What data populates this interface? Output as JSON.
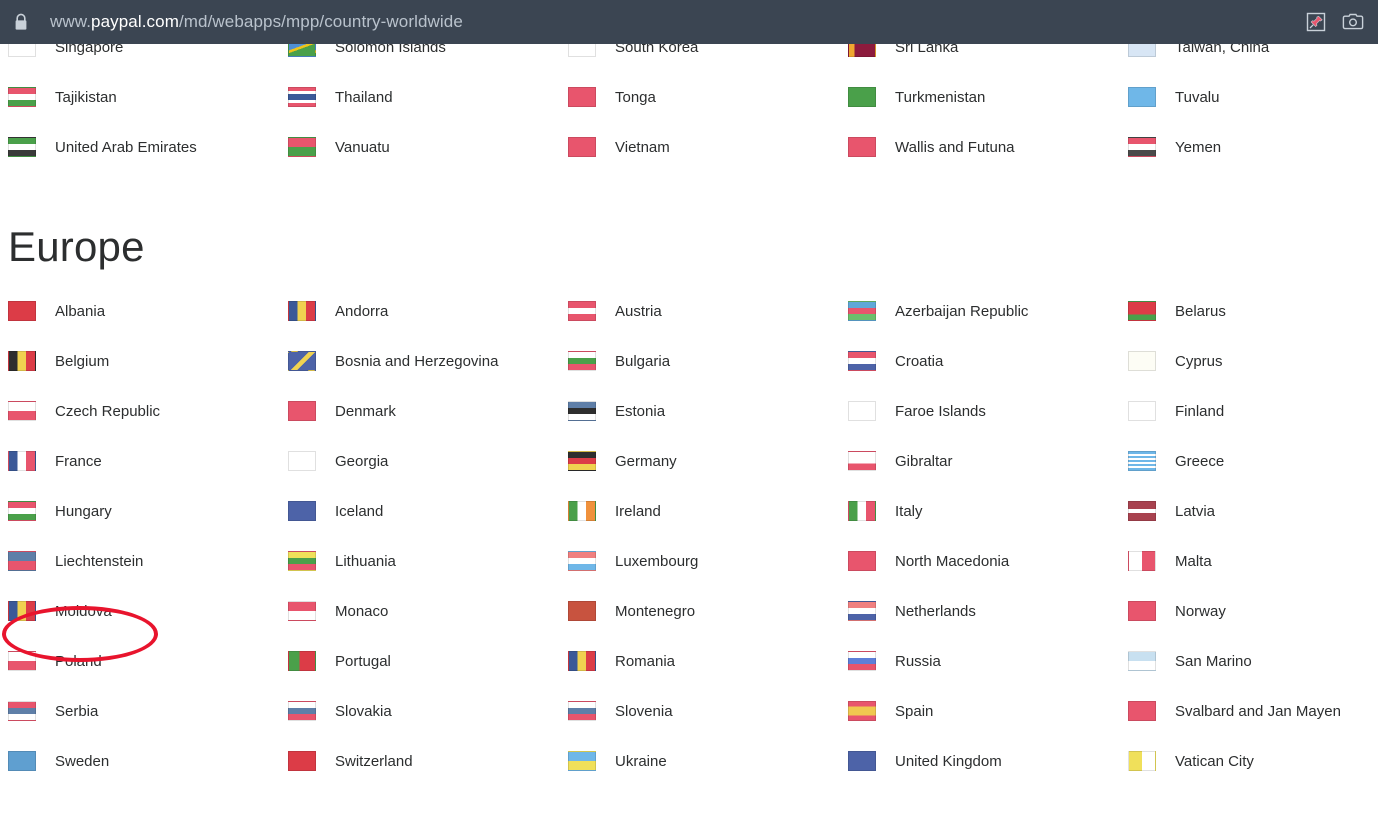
{
  "browser": {
    "url_prefix": "www.",
    "url_host": "paypal.com",
    "url_path": "/md/webapps/mpp/country-worldwide",
    "url_full": "www.paypal.com/md/webapps/mpp/country-worldwide",
    "lock_icon": "lock-icon",
    "pin_icon": "pin-icon",
    "camera_icon": "camera-icon"
  },
  "annotation": {
    "type": "red-ellipse",
    "color": "#e8142d",
    "target": "Moldova"
  },
  "clipped_section": {
    "rows": [
      [
        "Singapore",
        "Solomon Islands",
        "South Korea",
        "Sri Lanka",
        "Taiwan, China"
      ]
    ]
  },
  "asia_pacific": {
    "rows": [
      [
        "Tajikistan",
        "Thailand",
        "Tonga",
        "Turkmenistan",
        "Tuvalu"
      ],
      [
        "United Arab Emirates",
        "Vanuatu",
        "Vietnam",
        "Wallis and Futuna",
        "Yemen"
      ]
    ]
  },
  "europe": {
    "heading": "Europe",
    "rows": [
      [
        "Albania",
        "Andorra",
        "Austria",
        "Azerbaijan Republic",
        "Belarus"
      ],
      [
        "Belgium",
        "Bosnia and Herzegovina",
        "Bulgaria",
        "Croatia",
        "Cyprus"
      ],
      [
        "Czech Republic",
        "Denmark",
        "Estonia",
        "Faroe Islands",
        "Finland"
      ],
      [
        "France",
        "Georgia",
        "Germany",
        "Gibraltar",
        "Greece"
      ],
      [
        "Hungary",
        "Iceland",
        "Ireland",
        "Italy",
        "Latvia"
      ],
      [
        "Liechtenstein",
        "Lithuania",
        "Luxembourg",
        "North Macedonia",
        "Malta"
      ],
      [
        "Moldova",
        "Monaco",
        "Montenegro",
        "Netherlands",
        "Norway"
      ],
      [
        "Poland",
        "Portugal",
        "Romania",
        "Russia",
        "San Marino"
      ],
      [
        "Serbia",
        "Slovakia",
        "Slovenia",
        "Spain",
        "Svalbard and Jan Mayen"
      ],
      [
        "Sweden",
        "Switzerland",
        "Ukraine",
        "United Kingdom",
        "Vatican City"
      ]
    ]
  },
  "flag_styles": {
    "Singapore": "linear-gradient(#ffffff 0 50%, #ffffff 50% 100%)",
    "Solomon Islands": "linear-gradient(160deg, #4f8fd4 0 45%, #f0c419 45% 55%, #4aa04a 55% 100%)",
    "South Korea": "linear-gradient(#ffffff 0 100%)",
    "Sri Lanka": "linear-gradient(90deg, #f0a830 0 22%, #8d1b3d 22% 100%)",
    "Taiwan, China": "linear-gradient(#d8e6f5 0 100%)",
    "Tajikistan": "linear-gradient(#e8556d 0 33%, #ffffff 33% 66%, #4aa04a 66% 100%)",
    "Thailand": "linear-gradient(#e8556d 0 17%, #ffffff 17% 33%, #3b5998 33% 66%, #ffffff 66% 83%, #e8556d 83% 100%)",
    "Tonga": "linear-gradient(#e8556d 0 100%)",
    "Turkmenistan": "linear-gradient(#4aa04a 0 100%)",
    "Tuvalu": "linear-gradient(#6fb7e8 0 100%)",
    "United Arab Emirates": "linear-gradient(#4aa04a 0 33%, #ffffff 33% 66%, #3a3a3a 66% 100%)",
    "Vanuatu": "linear-gradient(#e8556d 0 50%, #4aa04a 50% 100%)",
    "Vietnam": "linear-gradient(#e8556d 0 100%)",
    "Wallis and Futuna": "linear-gradient(#e8556d 0 100%)",
    "Yemen": "linear-gradient(#e8556d 0 33%, #ffffff 33% 66%, #4a4a4a 66% 100%)",
    "Albania": "linear-gradient(#dc3c47 0 100%)",
    "Andorra": "linear-gradient(90deg, #3b5998 0 33%, #f0d250 33% 66%, #dc3c47 66% 100%)",
    "Austria": "linear-gradient(#e8556d 0 33%, #ffffff 33% 66%, #e8556d 66% 100%)",
    "Azerbaijan Republic": "linear-gradient(#5fa8d8 0 33%, #e8556d 33% 66%, #6cbf6c 66% 100%)",
    "Belarus": "linear-gradient(#dc3c47 0 70%, #4aa04a 70% 100%)",
    "Belgium": "linear-gradient(90deg, #2e2e2e 0 33%, #f0d250 33% 66%, #dc3c47 66% 100%)",
    "Bosnia and Herzegovina": "linear-gradient(135deg, #4d63a8 0 45%, #f0d250 45% 60%, #4d63a8 60% 100%)",
    "Bulgaria": "linear-gradient(#ffffff 0 33%, #4aa04a 33% 66%, #e8556d 66% 100%)",
    "Croatia": "linear-gradient(#e8556d 0 33%, #ffffff 33% 66%, #4d63a8 66% 100%)",
    "Cyprus": "linear-gradient(#fdfdf5 0 100%)",
    "Czech Republic": "linear-gradient(#ffffff 0 50%, #e8556d 50% 100%)",
    "Denmark": "linear-gradient(#e8556d 0 100%)",
    "Estonia": "linear-gradient(#5f7fa8 0 33%, #2e2e2e 33% 66%, #ffffff 66% 100%)",
    "Faroe Islands": "linear-gradient(#ffffff 0 100%)",
    "Finland": "linear-gradient(#ffffff 0 100%)",
    "France": "linear-gradient(90deg, #3b5998 0 33%, #ffffff 33% 66%, #e8556d 66% 100%)",
    "Georgia": "linear-gradient(#ffffff 0 100%)",
    "Germany": "linear-gradient(#2e2e2e 0 33%, #dc3c47 33% 66%, #f0d250 66% 100%)",
    "Gibraltar": "linear-gradient(#ffffff 0 65%, #e8556d 65% 100%)",
    "Greece": "repeating-linear-gradient(#6fb7e8 0 11%, #ffffff 11% 22%)",
    "Hungary": "linear-gradient(#e8556d 0 33%, #ffffff 33% 66%, #4aa04a 66% 100%)",
    "Iceland": "linear-gradient(#4d63a8 0 100%)",
    "Ireland": "linear-gradient(90deg, #4aa04a 0 33%, #ffffff 33% 66%, #f0913c 66% 100%)",
    "Italy": "linear-gradient(90deg, #4aa04a 0 33%, #ffffff 33% 66%, #e8556d 66% 100%)",
    "Latvia": "linear-gradient(#a8424f 0 40%, #ffffff 40% 60%, #a8424f 60% 100%)",
    "Liechtenstein": "linear-gradient(#5f7fa8 0 50%, #e8556d 50% 100%)",
    "Lithuania": "linear-gradient(#f0e05a 0 33%, #4aa04a 33% 66%, #e8556d 66% 100%)",
    "Luxembourg": "linear-gradient(#f08080 0 33%, #ffffff 33% 66%, #6fb7e8 66% 100%)",
    "North Macedonia": "linear-gradient(#e8556d 0 100%)",
    "Malta": "linear-gradient(90deg, #ffffff 0 50%, #e8556d 50% 100%)",
    "Moldova": "linear-gradient(90deg, #3b5998 0 33%, #f0d250 33% 66%, #dc3c47 66% 100%)",
    "Monaco": "linear-gradient(#e8556d 0 50%, #ffffff 50% 100%)",
    "Montenegro": "linear-gradient(#c8533f 0 100%)",
    "Netherlands": "linear-gradient(#f08080 0 33%, #ffffff 33% 66%, #4d63a8 66% 100%)",
    "Norway": "linear-gradient(#e8556d 0 100%)",
    "Poland": "linear-gradient(#ffffff 0 50%, #e8556d 50% 100%)",
    "Portugal": "linear-gradient(90deg, #4aa04a 0 40%, #dc3c47 40% 100%)",
    "Romania": "linear-gradient(90deg, #3b5998 0 33%, #f0d250 33% 66%, #dc3c47 66% 100%)",
    "Russia": "linear-gradient(#ffffff 0 33%, #5f7fd8 33% 66%, #e8556d 66% 100%)",
    "San Marino": "linear-gradient(#c8e0f0 0 50%, #ffffff 50% 100%)",
    "Serbia": "linear-gradient(#e8556d 0 33%, #5f7fa8 33% 66%, #ffffff 66% 100%)",
    "Slovakia": "linear-gradient(#ffffff 0 33%, #5f7fa8 33% 66%, #e8556d 66% 100%)",
    "Slovenia": "linear-gradient(#ffffff 0 33%, #5f7fa8 33% 66%, #e8556d 66% 100%)",
    "Spain": "linear-gradient(#e8556d 0 25%, #f0c850 25% 75%, #e8556d 75% 100%)",
    "Svalbard and Jan Mayen": "linear-gradient(#e8556d 0 100%)",
    "Sweden": "linear-gradient(#5f9fd0 0 100%)",
    "Switzerland": "linear-gradient(#dc3c47 0 100%)",
    "Ukraine": "linear-gradient(#6fb7e8 0 50%, #f0e05a 50% 100%)",
    "United Kingdom": "linear-gradient(#4d63a8 0 100%)",
    "Vatican City": "linear-gradient(90deg, #f0e05a 0 50%, #ffffff 50% 100%)"
  }
}
